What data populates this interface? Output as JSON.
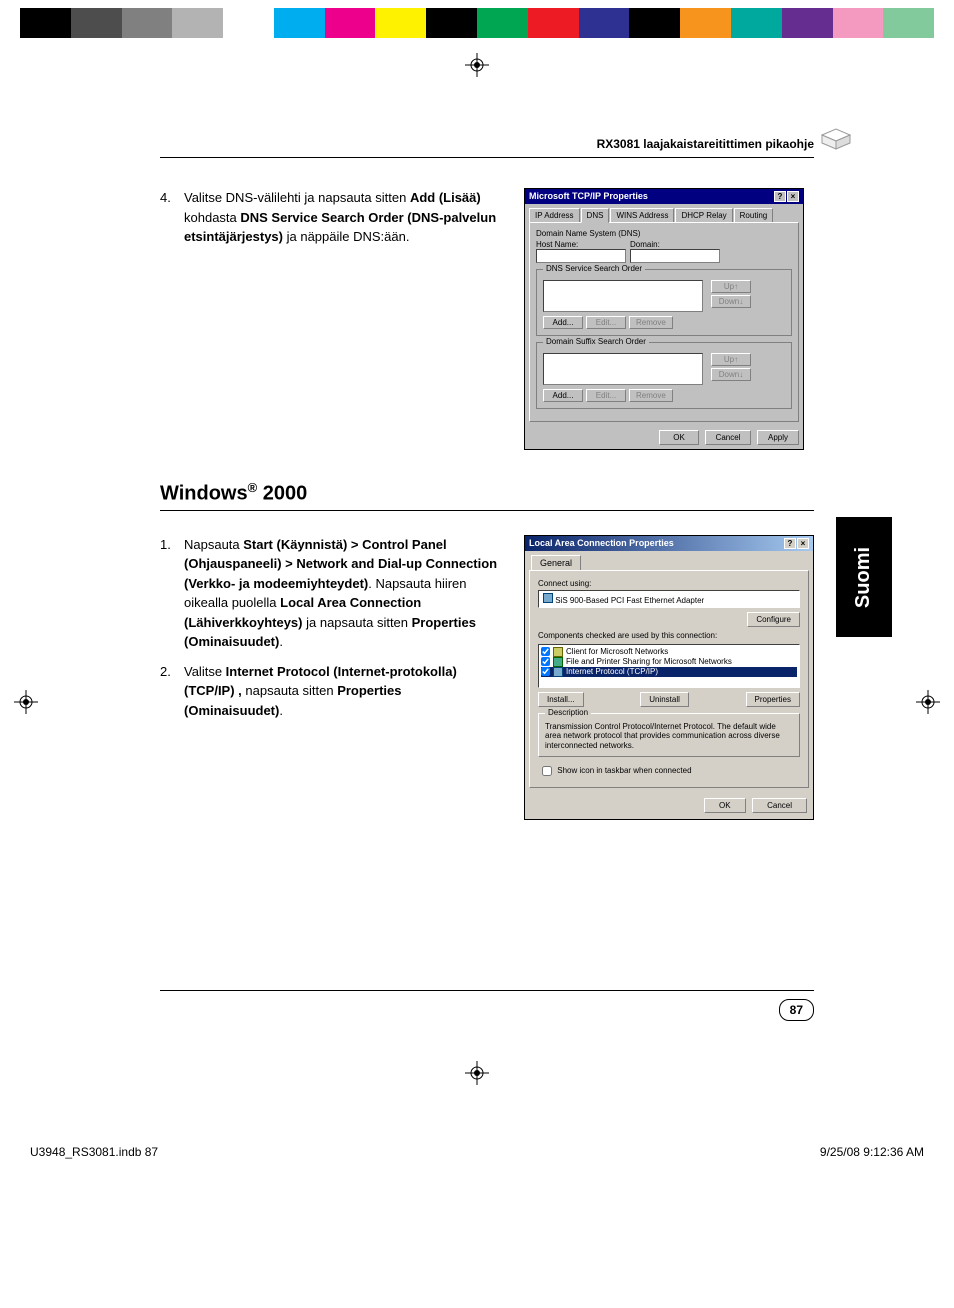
{
  "colorbar": [
    "#000000",
    "#4d4d4d",
    "#808080",
    "#b3b3b3",
    "#ffffff",
    "#00aeef",
    "#ec008c",
    "#fff200",
    "#000000",
    "#00a651",
    "#ed1c24",
    "#2e3192",
    "#000000",
    "#f7941d",
    "#00a99d",
    "#662d91",
    "#f49ac1",
    "#82ca9c"
  ],
  "header": {
    "title": "RX3081 laajakaistareitittimen pikaohje"
  },
  "step4": {
    "num": "4.",
    "text_pre": "Valitse DNS-välilehti ja napsauta sitten ",
    "bold1": "Add (Lisää)",
    "text_mid1": " kohdasta ",
    "bold2": "DNS Service Search Order (DNS-palvelun etsintäjärjestys)",
    "text_post": " ja näppäile DNS:ään."
  },
  "dialog1": {
    "title": "Microsoft TCP/IP Properties",
    "tabs": [
      "IP Address",
      "DNS",
      "WINS Address",
      "DHCP Relay",
      "Routing"
    ],
    "dns_group": "Domain Name System (DNS)",
    "host_label": "Host Name:",
    "domain_label": "Domain:",
    "sso_group": "DNS Service Search Order",
    "suffix_group": "Domain Suffix Search Order",
    "btn_up": "Up↑",
    "btn_down": "Down↓",
    "btn_add": "Add...",
    "btn_edit": "Edit...",
    "btn_remove": "Remove",
    "btn_ok": "OK",
    "btn_cancel": "Cancel",
    "btn_apply": "Apply"
  },
  "section_h_pre": "Windows",
  "section_h_sup": "®",
  "section_h_post": " 2000",
  "steps2": [
    {
      "num": "1.",
      "segments": [
        {
          "t": "Napsauta ",
          "b": false
        },
        {
          "t": "Start (Käynnistä) > Control Panel (Ohjauspaneeli) > Network and Dial-up Connection (Verkko- ja modeemiyhteydet)",
          "b": true
        },
        {
          "t": ". Napsauta hiiren oikealla puolella ",
          "b": false
        },
        {
          "t": "Local Area Connection (Lähiverkkoyhteys)",
          "b": true
        },
        {
          "t": " ja napsauta sitten ",
          "b": false
        },
        {
          "t": "Properties (Ominaisuudet)",
          "b": true
        },
        {
          "t": ".",
          "b": false
        }
      ]
    },
    {
      "num": "2.",
      "segments": [
        {
          "t": "Valitse ",
          "b": false
        },
        {
          "t": "Internet Protocol (Internet-protokolla) (TCP/IP) ,",
          "b": true
        },
        {
          "t": " napsauta sitten ",
          "b": false
        },
        {
          "t": "Properties (Ominaisuudet)",
          "b": true
        },
        {
          "t": ".",
          "b": false
        }
      ]
    }
  ],
  "dialog2": {
    "title": "Local Area Connection Properties",
    "tab": "General",
    "connect_using": "Connect using:",
    "adapter": "SiS 900-Based PCI Fast Ethernet Adapter",
    "btn_configure": "Configure",
    "components_label": "Components checked are used by this connection:",
    "components": [
      "Client for Microsoft Networks",
      "File and Printer Sharing for Microsoft Networks",
      "Internet Protocol (TCP/IP)"
    ],
    "btn_install": "Install...",
    "btn_uninstall": "Uninstall",
    "btn_properties": "Properties",
    "desc_group": "Description",
    "desc_text": "Transmission Control Protocol/Internet Protocol. The default wide area network protocol that provides communication across diverse interconnected networks.",
    "show_icon": "Show icon in taskbar when connected",
    "btn_ok": "OK",
    "btn_cancel": "Cancel"
  },
  "sidetab": "Suomi",
  "page_number": "87",
  "footer_left": "U3948_RS3081.indb   87",
  "footer_right": "9/25/08   9:12:36 AM"
}
